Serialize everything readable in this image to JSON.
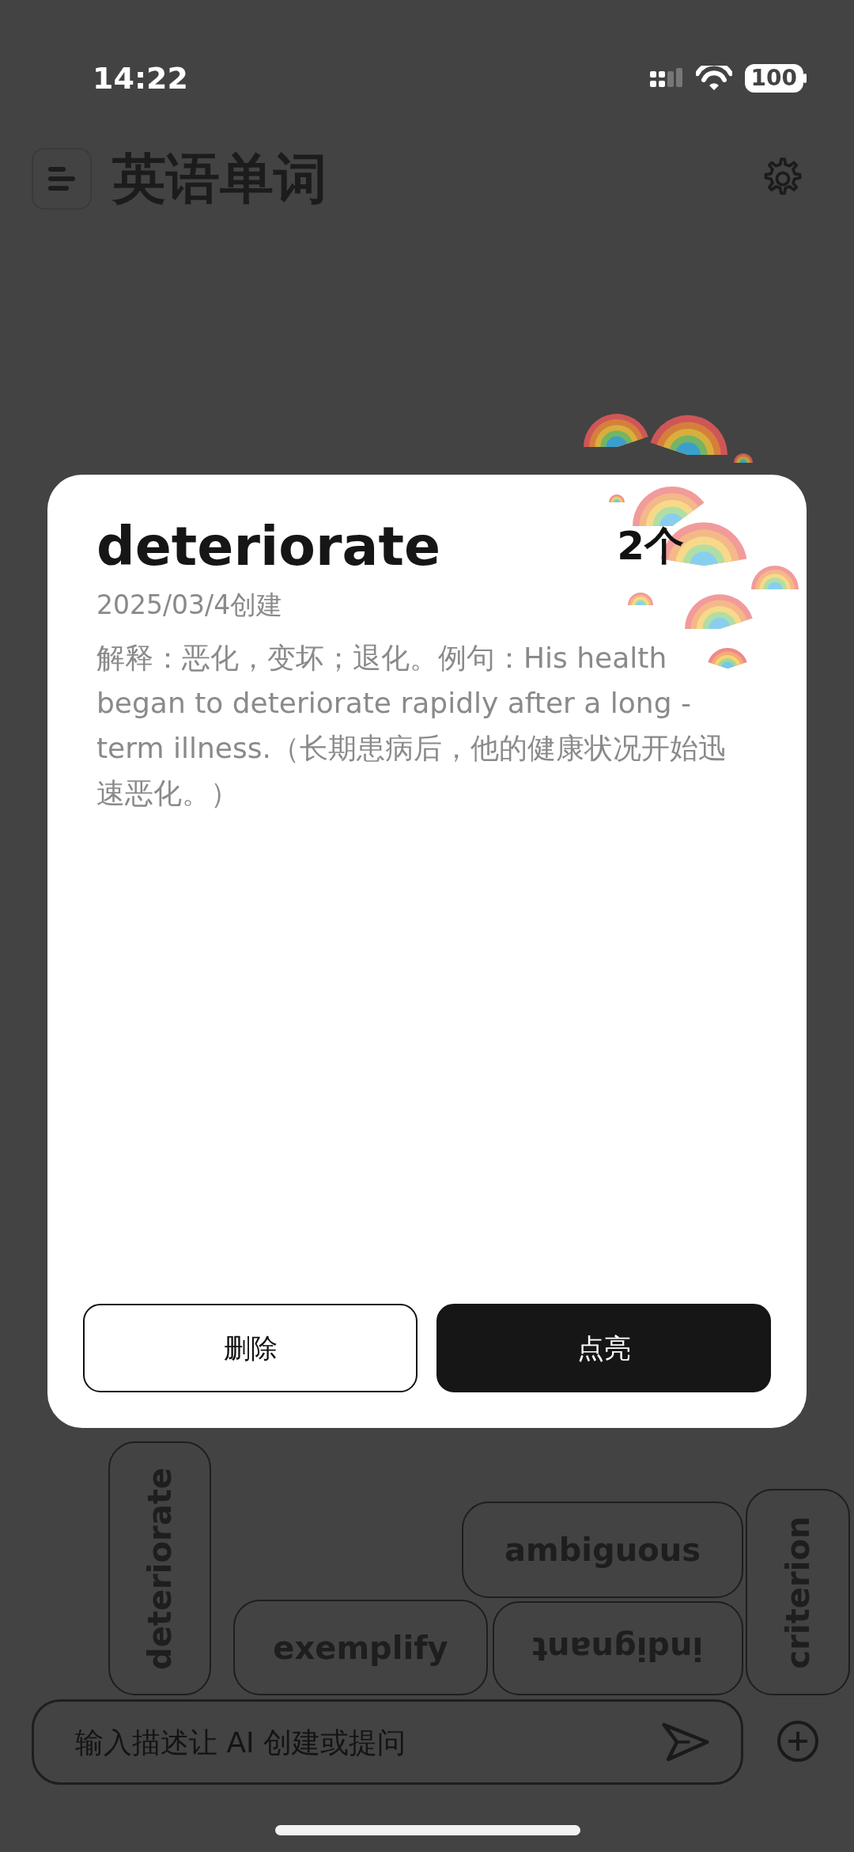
{
  "status_bar": {
    "time": "14:22",
    "battery": "100"
  },
  "header": {
    "title": "英语单词"
  },
  "dialog": {
    "word": "deteriorate",
    "count": "2个",
    "created": "2025/03/4创建",
    "explanation": "解释：恶化，变坏；退化。例句：His health began to deteriorate rapidly after a long - term illness.（长期患病后，他的健康状况开始迅速恶化。）",
    "buttons": [
      {
        "label": "删除",
        "kind": "outline"
      },
      {
        "label": "点亮",
        "kind": "filled"
      }
    ]
  },
  "tiles": [
    {
      "word": "deteriorate",
      "kind": "vertical"
    },
    {
      "word": "ambiguous",
      "kind": "horizontal"
    },
    {
      "word": "criterion",
      "kind": "vertical"
    },
    {
      "word": "exemplify",
      "kind": "horizontal"
    },
    {
      "word": "indignant",
      "kind": "upside-down"
    }
  ],
  "composer": {
    "placeholder": "输入描述让 AI 创建或提问"
  }
}
